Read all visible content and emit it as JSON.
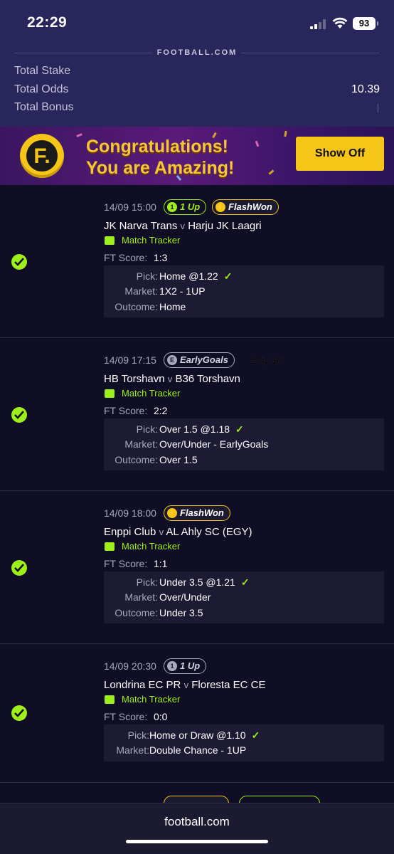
{
  "status": {
    "time": "22:29",
    "battery": "93"
  },
  "header": {
    "brand": "FOOTBALL.COM",
    "summary": [
      {
        "label": "Total Stake",
        "value": ""
      },
      {
        "label": "Total Odds",
        "value": "10.39"
      },
      {
        "label": "Total Bonus",
        "value": ""
      }
    ]
  },
  "banner": {
    "logo_letter": "F.",
    "line1": "Congratulations!",
    "line2": "You are Amazing!",
    "button": "Show Off"
  },
  "bets": [
    {
      "datetime": "14/09 15:00",
      "badges": [
        {
          "label": "1 Up",
          "style": "green"
        },
        {
          "label": "FlashWon",
          "style": "yellow"
        }
      ],
      "extra": "",
      "home": "JK Narva Trans",
      "away": "Harju JK Laagri",
      "tracker": "Match Tracker",
      "score_label": "FT Score:",
      "score": "1:3",
      "pick_label": "Pick:",
      "pick": "Home @1.22",
      "market_label": "Market:",
      "market": "1X2 - 1UP",
      "outcome_label": "Outcome:",
      "outcome": "Home"
    },
    {
      "datetime": "14/09 17:15",
      "badges": [
        {
          "label": "EarlyGoals",
          "style": "grey"
        }
      ],
      "extra": "1 by 10'",
      "home": "HB Torshavn",
      "away": "B36 Torshavn",
      "tracker": "Match Tracker",
      "score_label": "FT Score:",
      "score": "2:2",
      "pick_label": "Pick:",
      "pick": "Over 1.5 @1.18",
      "market_label": "Market:",
      "market": "Over/Under - EarlyGoals",
      "outcome_label": "Outcome:",
      "outcome": "Over 1.5"
    },
    {
      "datetime": "14/09 18:00",
      "badges": [
        {
          "label": "FlashWon",
          "style": "yellow"
        }
      ],
      "extra": "",
      "home": "Enppi Club",
      "away": "AL Ahly SC (EGY)",
      "tracker": "Match Tracker",
      "score_label": "FT Score:",
      "score": "1:1",
      "pick_label": "Pick:",
      "pick": "Under 3.5 @1.21",
      "market_label": "Market:",
      "market": "Over/Under",
      "outcome_label": "Outcome:",
      "outcome": "Under 3.5"
    },
    {
      "datetime": "14/09 20:30",
      "badges": [
        {
          "label": "1 Up",
          "style": "grey"
        }
      ],
      "extra": "",
      "home": "Londrina EC PR",
      "away": "Floresta EC CE",
      "tracker": "Match Tracker",
      "score_label": "FT Score:",
      "score": "0:0",
      "pick_label": "Pick:",
      "pick": "Home or Draw @1.10",
      "market_label": "Market:",
      "market": "Double Chance - 1UP"
    }
  ],
  "versus": "v",
  "footer": {
    "site": "football.com"
  },
  "colors": {
    "accent_green": "#9ef01a",
    "accent_yellow": "#f5c518",
    "header_bg": "#28265a",
    "page_bg": "#0f0e24"
  }
}
